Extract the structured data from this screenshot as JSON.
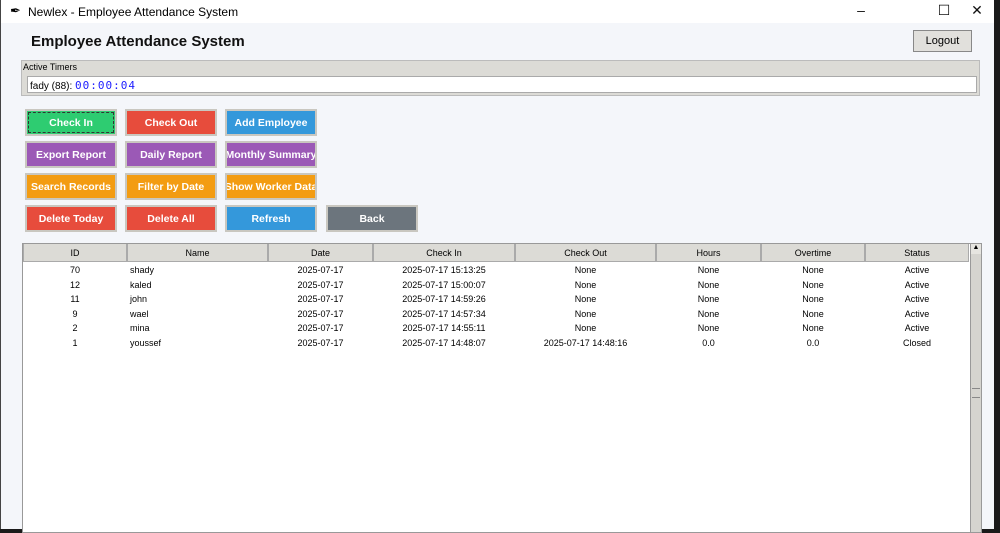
{
  "window": {
    "title": "Newlex - Employee Attendance System",
    "minimize": "–",
    "maximize": "☐",
    "close": "✕"
  },
  "header": {
    "title": "Employee Attendance System",
    "logout": "Logout"
  },
  "timers": {
    "label": "Active Timers",
    "entry_name": "fady (88):",
    "entry_time": "00:00:04"
  },
  "buttons": [
    {
      "label": "Check In",
      "color": "#2ecc71"
    },
    {
      "label": "Check Out",
      "color": "#e74c3c"
    },
    {
      "label": "Add Employee",
      "color": "#3498db"
    },
    {
      "label": "Export Report",
      "color": "#9b59b6"
    },
    {
      "label": "Daily Report",
      "color": "#9b59b6"
    },
    {
      "label": "Monthly Summary",
      "color": "#9b59b6"
    },
    {
      "label": "Search Records",
      "color": "#f39c12"
    },
    {
      "label": "Filter by Date",
      "color": "#f39c12"
    },
    {
      "label": "Show Worker Data",
      "color": "#f39c12"
    },
    {
      "label": "Delete Today",
      "color": "#e74c3c"
    },
    {
      "label": "Delete All",
      "color": "#e74c3c"
    },
    {
      "label": "Refresh",
      "color": "#3498db"
    },
    {
      "label": "Back",
      "color": "#6c757d"
    }
  ],
  "table": {
    "columns": [
      "ID",
      "Name",
      "Date",
      "Check In",
      "Check Out",
      "Hours",
      "Overtime",
      "Status"
    ],
    "rows": [
      [
        "70",
        "shady",
        "2025-07-17",
        "2025-07-17 15:13:25",
        "None",
        "None",
        "None",
        "Active"
      ],
      [
        "12",
        "kaled",
        "2025-07-17",
        "2025-07-17 15:00:07",
        "None",
        "None",
        "None",
        "Active"
      ],
      [
        "11",
        "john",
        "2025-07-17",
        "2025-07-17 14:59:26",
        "None",
        "None",
        "None",
        "Active"
      ],
      [
        "9",
        "wael",
        "2025-07-17",
        "2025-07-17 14:57:34",
        "None",
        "None",
        "None",
        "Active"
      ],
      [
        "2",
        "mina",
        "2025-07-17",
        "2025-07-17 14:55:11",
        "None",
        "None",
        "None",
        "Active"
      ],
      [
        "1",
        "youssef",
        "2025-07-17",
        "2025-07-17 14:48:07",
        "2025-07-17 14:48:16",
        "0.0",
        "0.0",
        "Closed"
      ]
    ]
  }
}
